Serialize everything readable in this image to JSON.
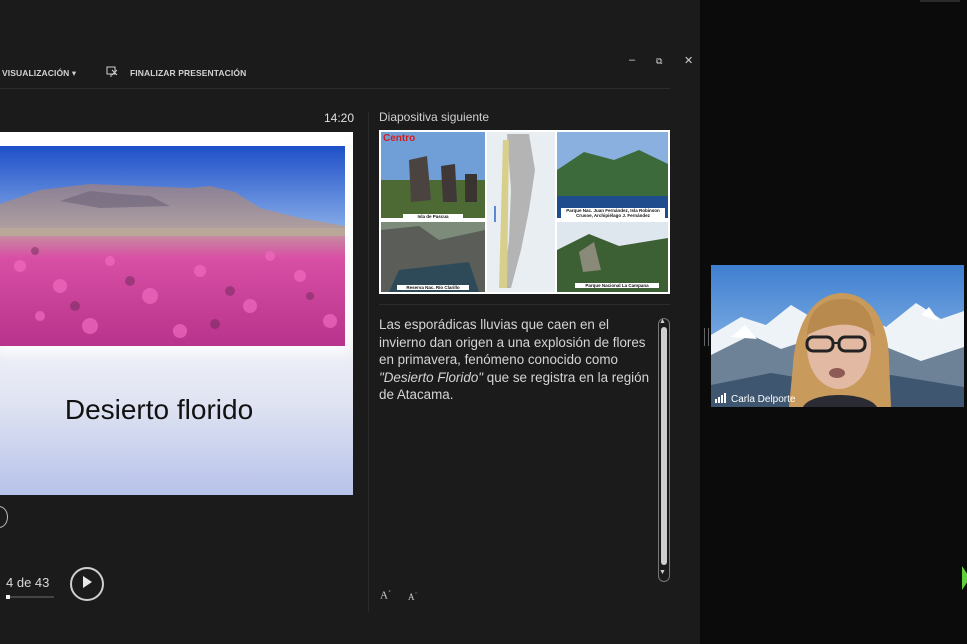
{
  "toolbar": {
    "visualization_label": "VISUALIZACIÓN ▾",
    "end_presentation_label": "FINALIZAR PRESENTACIÓN"
  },
  "window_controls": {
    "minimize": "–",
    "restore": "⧉",
    "close": "✕"
  },
  "timer": "14:20",
  "current_slide": {
    "title": "Desierto florido",
    "counter": "4 de 43",
    "progress_fraction": 0.093
  },
  "next_slide": {
    "label": "Diapositiva siguiente",
    "badge": "Centro",
    "captions": {
      "isla_pascua": "Isla de Pascua",
      "juan_fernandez": "Parque Nac. Juan Fernández, Isla Robinson Crusoe, Archipiélago J. Fernández",
      "rio_clarillo": "Reserva Nac. Río Clarillo",
      "la_campana": "Parque Nacional La Campana"
    }
  },
  "notes": {
    "part1": "Las esporádicas lluvias que caen en el invierno dan origen a una explosión de flores en primavera, fenómeno conocido como ",
    "part2": "\"Desierto Florido\"",
    "part3": " que se registra en la región de Atacama."
  },
  "font_controls": {
    "increase": "A",
    "decrease": "A"
  },
  "participant": {
    "name": "Carla Delporte"
  },
  "colors": {
    "accent_green": "#5fcf3a",
    "badge_red": "#d11d1d"
  }
}
